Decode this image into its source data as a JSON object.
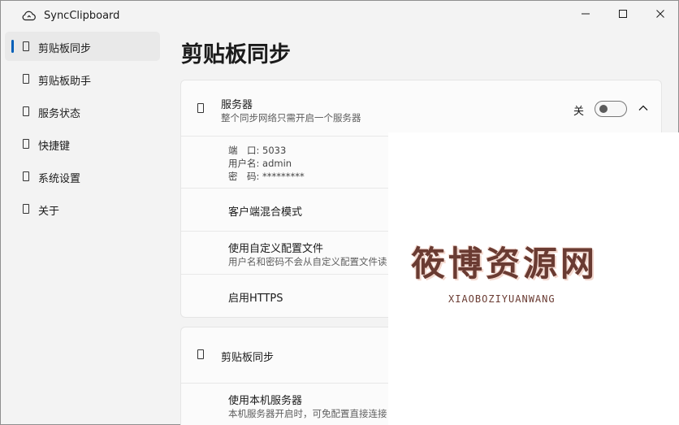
{
  "window": {
    "title": "SyncClipboard",
    "icon": "cloud-sync-icon"
  },
  "sidebar": {
    "items": [
      {
        "label": "剪贴板同步",
        "icon": "clipboard-sync-icon",
        "active": true
      },
      {
        "label": "剪贴板助手",
        "icon": "clipboard-assistant-icon",
        "active": false
      },
      {
        "label": "服务状态",
        "icon": "service-status-icon",
        "active": false
      },
      {
        "label": "快捷键",
        "icon": "hotkey-icon",
        "active": false
      },
      {
        "label": "系统设置",
        "icon": "settings-icon",
        "active": false
      },
      {
        "label": "关于",
        "icon": "about-icon",
        "active": false
      }
    ]
  },
  "main": {
    "title": "剪贴板同步",
    "server_card": {
      "title": "服务器",
      "subtitle": "整个同步网络只需开启一个服务器",
      "toggle_label": "关",
      "toggle_on": false,
      "port_line": "端　口: 5033",
      "user_line": "用户名: admin",
      "pass_line": "密　码: *********",
      "mixed_mode_title": "客户端混合模式",
      "custom_config_title": "使用自定义配置文件",
      "custom_config_subtitle": "用户名和密码不会从自定义配置文件读",
      "https_title": "启用HTTPS"
    },
    "sync_card": {
      "title": "剪贴板同步",
      "local_server_title": "使用本机服务器",
      "local_server_subtitle": "本机服务器开启时，可免配置直接连接"
    }
  },
  "watermark": {
    "text": "筱博资源网",
    "subtext": "XIAOBOZIYUANWANG"
  },
  "colors": {
    "accent": "#005fb8",
    "background": "#f3f3f3",
    "card": "#fbfbfb"
  }
}
